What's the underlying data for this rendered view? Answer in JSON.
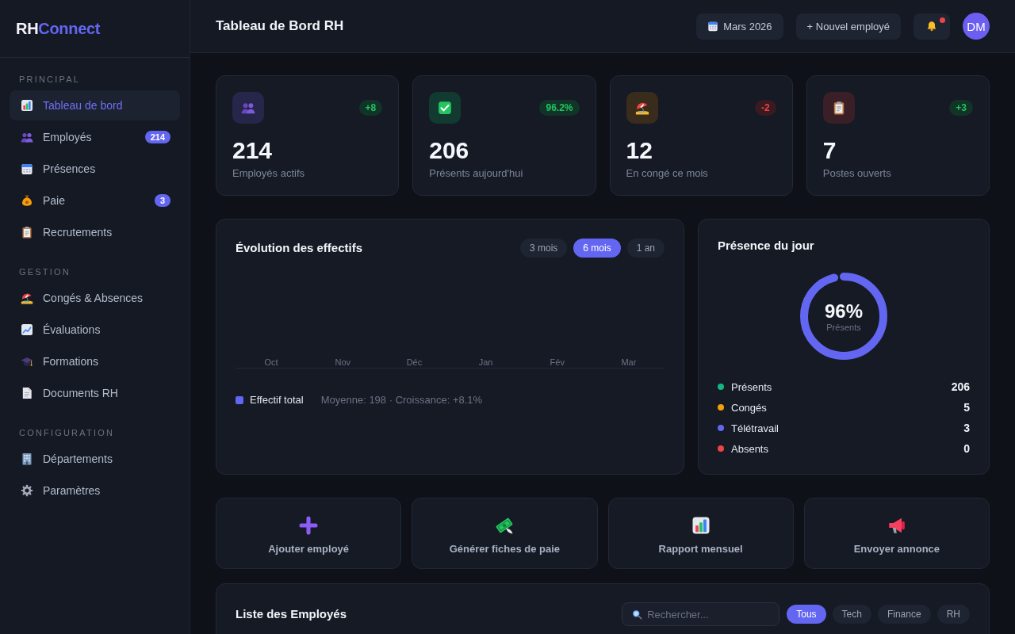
{
  "sidebar": {
    "logo": {
      "prefix": "RH",
      "accent": "Connect"
    },
    "sections": [
      {
        "title": "PRINCIPAL",
        "items": [
          {
            "label": "Tableau de bord",
            "kind": "dashboard",
            "selected": true
          },
          {
            "label": "Employés",
            "kind": "employees",
            "selected": false,
            "badge": "214"
          },
          {
            "label": "Présences",
            "kind": "attendance",
            "selected": false
          },
          {
            "label": "Paie",
            "kind": "payroll",
            "selected": false,
            "badge": "3"
          },
          {
            "label": "Recrutements",
            "kind": "recruitment",
            "selected": false
          }
        ]
      },
      {
        "title": "GESTION",
        "items": [
          {
            "label": "Congés & Absences",
            "kind": "leave",
            "selected": false
          },
          {
            "label": "Évaluations",
            "kind": "reviews",
            "selected": false
          },
          {
            "label": "Formations",
            "kind": "training",
            "selected": false
          },
          {
            "label": "Documents RH",
            "kind": "documents",
            "selected": false
          }
        ]
      },
      {
        "title": "CONFIGURATION",
        "items": [
          {
            "label": "Départements",
            "kind": "departments",
            "selected": false
          },
          {
            "label": "Paramètres",
            "kind": "settings",
            "selected": false
          }
        ]
      }
    ]
  },
  "header": {
    "title": "Tableau de Bord RH",
    "period_button": {
      "label": "Mars 2026"
    },
    "new_button": {
      "label": "+ Nouvel employé"
    },
    "notifications": {
      "unread": true
    },
    "avatar": {
      "initials": "DM"
    }
  },
  "stats": [
    {
      "kind": "employees",
      "value": "214",
      "label": "Employés actifs",
      "change": "+8",
      "positive": true
    },
    {
      "kind": "presence",
      "value": "206",
      "label": "Présents aujourd'hui",
      "change": "96.2%",
      "positive": true
    },
    {
      "kind": "leave",
      "value": "12",
      "label": "En congé ce mois",
      "change": "-2",
      "positive": false
    },
    {
      "kind": "openings",
      "value": "7",
      "label": "Postes ouverts",
      "change": "+3",
      "positive": true
    }
  ],
  "headcount_chart": {
    "title": "Évolution des effectifs",
    "periods": [
      {
        "label": "3 mois",
        "selected": false
      },
      {
        "label": "6 mois",
        "selected": true
      },
      {
        "label": "1 an",
        "selected": false
      }
    ],
    "axis_labels": [
      "Oct",
      "Nov",
      "Déc",
      "Jan",
      "Fév",
      "Mar"
    ],
    "legend": [
      {
        "label": "Effectif total",
        "color": "#6366f1"
      }
    ],
    "summary": "Moyenne: 198 · Croissance: +8.1%"
  },
  "presence": {
    "title": "Présence du jour",
    "ring": {
      "level": 0.96,
      "value": "96%",
      "caption": "Présents"
    },
    "breakdown": [
      {
        "label": "Présents",
        "value": "206",
        "color": "#10b981"
      },
      {
        "label": "Congés",
        "value": "5",
        "color": "#f59e0b"
      },
      {
        "label": "Télétravail",
        "value": "3",
        "color": "#6366f1"
      },
      {
        "label": "Absents",
        "value": "0",
        "color": "#ef4444"
      }
    ]
  },
  "quick_actions": [
    {
      "kind": "add",
      "label": "Ajouter employé"
    },
    {
      "kind": "payroll",
      "label": "Générer fiches de paie"
    },
    {
      "kind": "report",
      "label": "Rapport mensuel"
    },
    {
      "kind": "announce",
      "label": "Envoyer annonce"
    }
  ],
  "employee_list": {
    "title": "Liste des Employés",
    "search": {
      "placeholder": "Rechercher..."
    },
    "filters": [
      {
        "label": "Tous",
        "selected": true
      },
      {
        "label": "Tech",
        "selected": false
      },
      {
        "label": "Finance",
        "selected": false
      },
      {
        "label": "RH",
        "selected": false
      }
    ]
  }
}
